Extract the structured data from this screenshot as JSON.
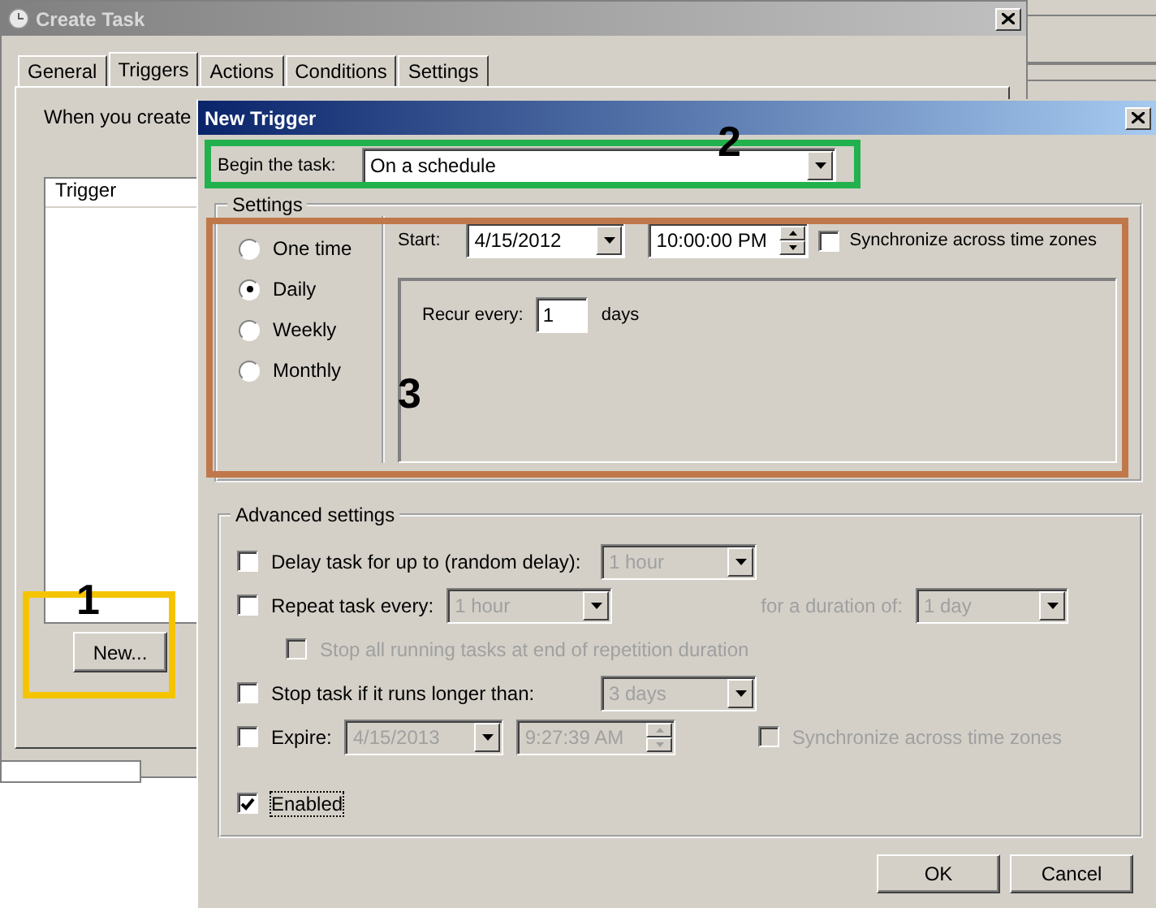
{
  "create_task": {
    "title": "Create Task",
    "tabs": [
      {
        "label": "General",
        "selected": false
      },
      {
        "label": "Triggers",
        "selected": true
      },
      {
        "label": "Actions",
        "selected": false
      },
      {
        "label": "Conditions",
        "selected": false
      },
      {
        "label": "Settings",
        "selected": false
      }
    ],
    "intro": "When you create",
    "list_column": "Trigger",
    "new_button": "New..."
  },
  "new_trigger": {
    "title": "New Trigger",
    "begin_label": "Begin the task:",
    "begin_value": "On a schedule",
    "settings": {
      "legend": "Settings",
      "schedules": [
        {
          "label": "One time",
          "selected": false
        },
        {
          "label": "Daily",
          "selected": true
        },
        {
          "label": "Weekly",
          "selected": false
        },
        {
          "label": "Monthly",
          "selected": false
        }
      ],
      "start_label": "Start:",
      "start_date": "4/15/2012",
      "start_time": "10:00:00 PM",
      "sync": {
        "label": "Synchronize across time zones",
        "checked": false
      },
      "recur_label": "Recur every:",
      "recur_value": "1",
      "recur_unit": "days"
    },
    "advanced": {
      "legend": "Advanced settings",
      "delay": {
        "label": "Delay task for up to (random delay):",
        "checked": false,
        "value": "1 hour",
        "disabled": true
      },
      "repeat": {
        "label": "Repeat task every:",
        "checked": false,
        "value": "1 hour",
        "disabled": true,
        "duration_label": "for a duration of:",
        "duration_value": "1 day"
      },
      "stop_all": {
        "label": "Stop all running tasks at end of repetition duration",
        "checked": false,
        "disabled": true
      },
      "stop_task": {
        "label": "Stop task if it runs longer than:",
        "checked": false,
        "value": "3 days",
        "disabled": true
      },
      "expire": {
        "label": "Expire:",
        "checked": false,
        "date": "4/15/2013",
        "time": "9:27:39 AM",
        "disabled": true,
        "sync_label": "Synchronize across time zones",
        "sync_checked": false
      },
      "enabled": {
        "label": "Enabled",
        "checked": true
      }
    },
    "buttons": [
      {
        "label": "OK"
      },
      {
        "label": "Cancel"
      }
    ]
  },
  "annotations": [
    {
      "number": "1",
      "color": "#f5c400"
    },
    {
      "number": "2",
      "color": "#22b14c"
    },
    {
      "number": "3",
      "color": "#c0784a"
    }
  ]
}
